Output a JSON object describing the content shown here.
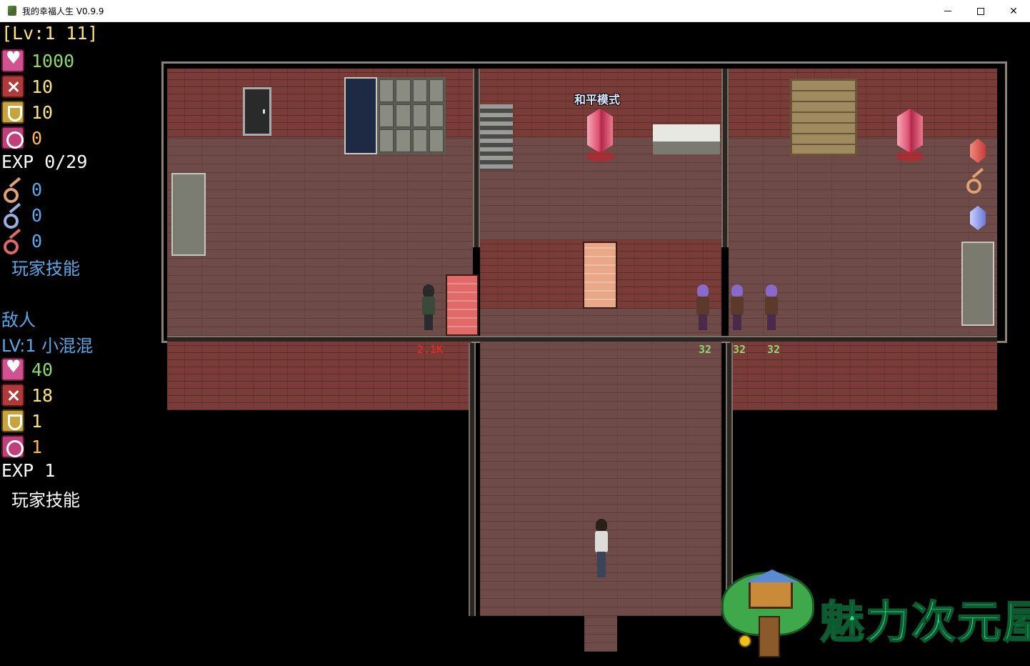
{
  "window": {
    "title": "我的幸福人生 V0.9.9"
  },
  "player": {
    "level_line": "[Lv:1 11]",
    "hp": "1000",
    "atk": "10",
    "def": "10",
    "magic": "0",
    "exp": "EXP 0/29",
    "keys": {
      "yellow": "0",
      "blue": "0",
      "red": "0"
    },
    "skills_label": "玩家技能"
  },
  "enemy": {
    "header": "敌人",
    "name_line": "LV:1 小混混",
    "hp": "40",
    "atk": "18",
    "def": "1",
    "magic": "1",
    "exp": "EXP  1",
    "skills_label": "玩家技能"
  },
  "map": {
    "peace_mode": "和平模式",
    "damage_labels": {
      "thug_guard": "2.1K",
      "enemy_1": "32",
      "enemy_2": "32",
      "enemy_3": "32"
    }
  },
  "watermark": "魅力次元屋",
  "colors": {
    "hp": "#8fd86a",
    "atk": "#ffe37a",
    "def": "#ffe37a",
    "magic": "#ffb84a",
    "key_yellow": "#5aa8e8",
    "skill_player": "#5aa8e8",
    "enemy_name": "#5aa8e8"
  }
}
